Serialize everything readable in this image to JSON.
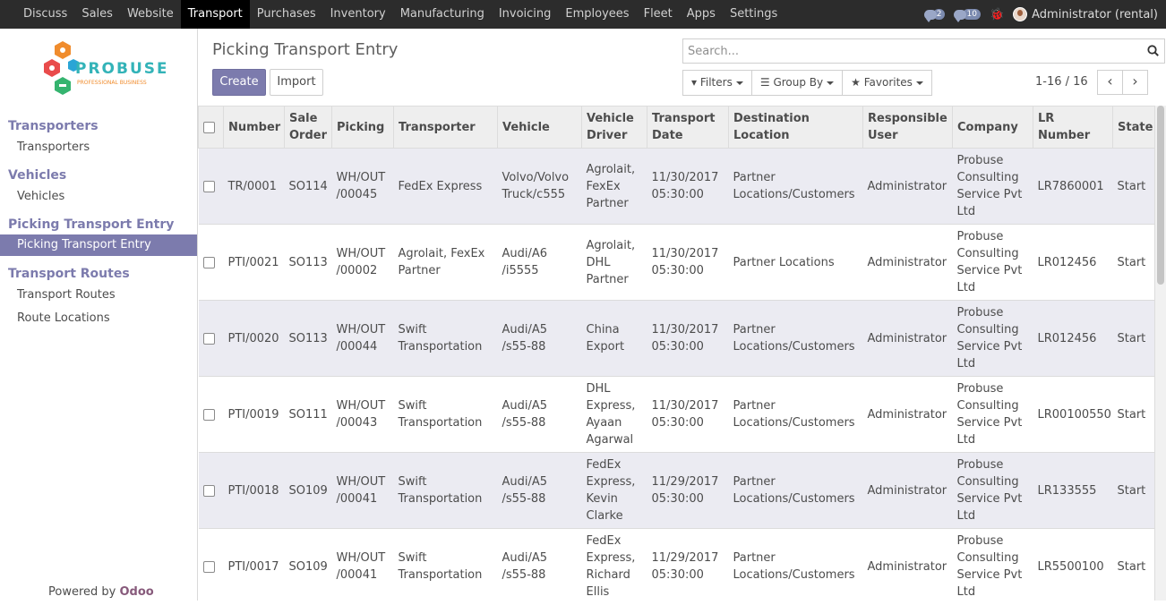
{
  "topbar": {
    "menu": [
      "Discuss",
      "Sales",
      "Website",
      "Transport",
      "Purchases",
      "Inventory",
      "Manufacturing",
      "Invoicing",
      "Employees",
      "Fleet",
      "Apps",
      "Settings"
    ],
    "active_index": 3,
    "chat_count": "2",
    "activity_count": "10",
    "user": "Administrator (rental)"
  },
  "sidebar": {
    "logo_text": "PROBUSE",
    "logo_sub": "PROFESSIONAL BUSINESS",
    "sections": [
      {
        "heading": "Transporters",
        "links": [
          "Transporters"
        ]
      },
      {
        "heading": "Vehicles",
        "links": [
          "Vehicles"
        ]
      },
      {
        "heading": "Picking Transport Entry",
        "links": [
          "Picking Transport Entry"
        ]
      },
      {
        "heading": "Transport Routes",
        "links": [
          "Transport Routes",
          "Route Locations"
        ]
      }
    ],
    "active_link": "Picking Transport Entry",
    "powered_prefix": "Powered by",
    "powered_brand": "Odoo"
  },
  "control": {
    "title": "Picking Transport Entry",
    "create_label": "Create",
    "import_label": "Import",
    "search_placeholder": "Search...",
    "filters_label": "Filters",
    "groupby_label": "Group By",
    "favorites_label": "Favorites",
    "pager": "1-16 / 16"
  },
  "table": {
    "columns": [
      [
        "Number"
      ],
      [
        "Sale",
        "Order"
      ],
      [
        "Picking"
      ],
      [
        "Transporter"
      ],
      [
        "Vehicle"
      ],
      [
        "Vehicle",
        "Driver"
      ],
      [
        "Transport",
        "Date"
      ],
      [
        "Destination",
        "Location"
      ],
      [
        "Responsible",
        "User"
      ],
      [
        "Company"
      ],
      [
        "LR",
        "Number"
      ],
      [
        "State"
      ]
    ],
    "rows": [
      {
        "number": "TR/0001",
        "order": "SO114",
        "picking": [
          "WH/OUT",
          "/00045"
        ],
        "transporter": [
          "FedEx Express"
        ],
        "vehicle": [
          "Volvo/Volvo",
          "Truck/c555"
        ],
        "driver": [
          "Agrolait,",
          "FexEx",
          "Partner"
        ],
        "date": [
          "11/30/2017",
          "05:30:00"
        ],
        "dest": [
          "Partner",
          "Locations/Customers"
        ],
        "user": "Administrator",
        "company": [
          "Probuse",
          "Consulting",
          "Service Pvt",
          "Ltd"
        ],
        "lr": "LR7860001",
        "state": "Start"
      },
      {
        "number": "PTI/0021",
        "order": "SO113",
        "picking": [
          "WH/OUT",
          "/00002"
        ],
        "transporter": [
          "Agrolait, FexEx",
          "Partner"
        ],
        "vehicle": [
          "Audi/A6",
          "/i5555"
        ],
        "driver": [
          "Agrolait,",
          "DHL",
          "Partner"
        ],
        "date": [
          "11/30/2017",
          "05:30:00"
        ],
        "dest": [
          "Partner Locations"
        ],
        "user": "Administrator",
        "company": [
          "Probuse",
          "Consulting",
          "Service Pvt",
          "Ltd"
        ],
        "lr": "LR012456",
        "state": "Start"
      },
      {
        "number": "PTI/0020",
        "order": "SO113",
        "picking": [
          "WH/OUT",
          "/00044"
        ],
        "transporter": [
          "Swift",
          "Transportation"
        ],
        "vehicle": [
          "Audi/A5",
          "/s55-88"
        ],
        "driver": [
          "China",
          "Export"
        ],
        "date": [
          "11/30/2017",
          "05:30:00"
        ],
        "dest": [
          "Partner",
          "Locations/Customers"
        ],
        "user": "Administrator",
        "company": [
          "Probuse",
          "Consulting",
          "Service Pvt",
          "Ltd"
        ],
        "lr": "LR012456",
        "state": "Start"
      },
      {
        "number": "PTI/0019",
        "order": "SO111",
        "picking": [
          "WH/OUT",
          "/00043"
        ],
        "transporter": [
          "Swift",
          "Transportation"
        ],
        "vehicle": [
          "Audi/A5",
          "/s55-88"
        ],
        "driver": [
          "DHL",
          "Express,",
          "Ayaan",
          "Agarwal"
        ],
        "date": [
          "11/30/2017",
          "05:30:00"
        ],
        "dest": [
          "Partner",
          "Locations/Customers"
        ],
        "user": "Administrator",
        "company": [
          "Probuse",
          "Consulting",
          "Service Pvt",
          "Ltd"
        ],
        "lr": "LR00100550",
        "state": "Start"
      },
      {
        "number": "PTI/0018",
        "order": "SO109",
        "picking": [
          "WH/OUT",
          "/00041"
        ],
        "transporter": [
          "Swift",
          "Transportation"
        ],
        "vehicle": [
          "Audi/A5",
          "/s55-88"
        ],
        "driver": [
          "FedEx",
          "Express,",
          "Kevin",
          "Clarke"
        ],
        "date": [
          "11/29/2017",
          "05:30:00"
        ],
        "dest": [
          "Partner",
          "Locations/Customers"
        ],
        "user": "Administrator",
        "company": [
          "Probuse",
          "Consulting",
          "Service Pvt",
          "Ltd"
        ],
        "lr": "LR133555",
        "state": "Start"
      },
      {
        "number": "PTI/0017",
        "order": "SO109",
        "picking": [
          "WH/OUT",
          "/00041"
        ],
        "transporter": [
          "Swift",
          "Transportation"
        ],
        "vehicle": [
          "Audi/A5",
          "/s55-88"
        ],
        "driver": [
          "FedEx",
          "Express,",
          "Richard",
          "Ellis"
        ],
        "date": [
          "11/29/2017",
          "05:30:00"
        ],
        "dest": [
          "Partner",
          "Locations/Customers"
        ],
        "user": "Administrator",
        "company": [
          "Probuse",
          "Consulting",
          "Service Pvt",
          "Ltd"
        ],
        "lr": "LR5500100",
        "state": "Start"
      }
    ]
  },
  "colors": {
    "brand": "#7c7bad",
    "navbar": "#2c2c2c",
    "row_alt": "#ebebf2"
  }
}
